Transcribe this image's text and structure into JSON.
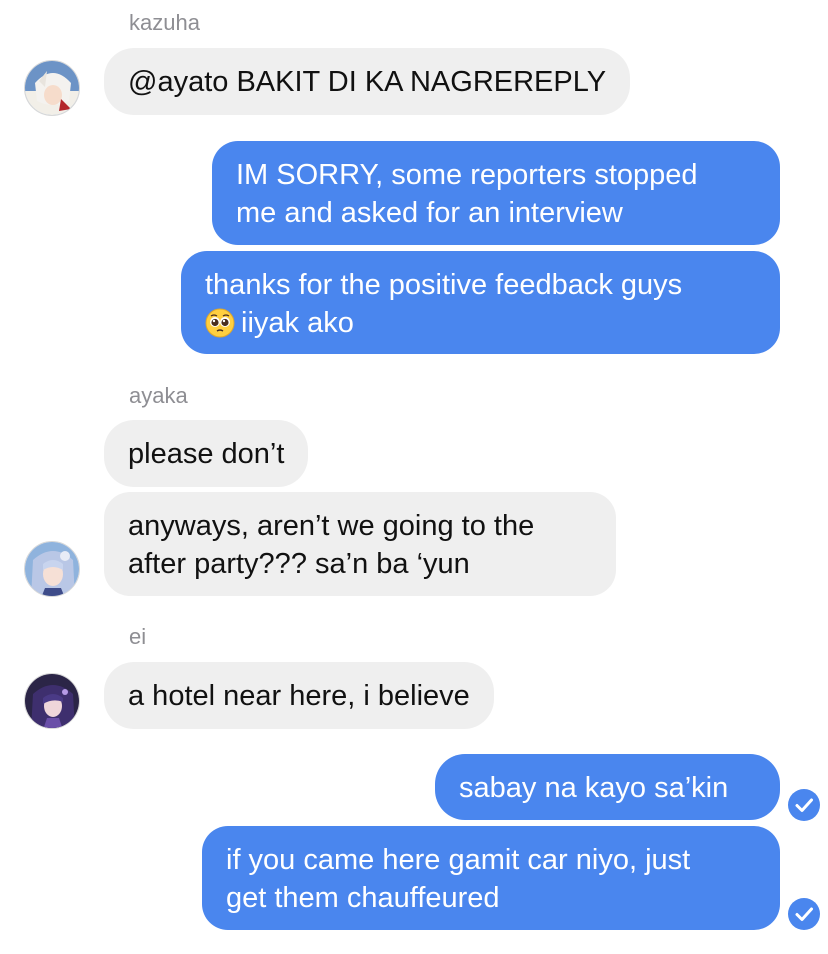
{
  "chat": {
    "groups": [
      {
        "sender": "kazuha",
        "avatar": "kazuha-avatar",
        "messages": [
          "@ayato BAKIT DI KA NAGREREPLY"
        ]
      },
      {
        "sender": "me",
        "messages": [
          {
            "lines": [
              "IM SORRY, some reporters stopped",
              "me and asked for an interview"
            ]
          },
          {
            "lines": [
              "thanks for the positive feedback guys",
              "iiyak ako"
            ],
            "emoji": "pleading-face-emoji"
          }
        ]
      },
      {
        "sender": "ayaka",
        "avatar": "ayaka-avatar",
        "messages": [
          "please don’t",
          {
            "lines": [
              "anyways, aren’t we going to the",
              "after party??? sa’n ba ‘yun"
            ]
          }
        ]
      },
      {
        "sender": "ei",
        "avatar": "ei-avatar",
        "messages": [
          "a hotel near here, i believe"
        ]
      },
      {
        "sender": "me",
        "messages": [
          {
            "text": "sabay na kayo sa’kin",
            "status": "read-check-icon"
          },
          {
            "lines": [
              "if you came here gamit car niyo, just",
              "get them chauffeured"
            ],
            "status": "read-check-icon"
          }
        ]
      }
    ]
  },
  "colors": {
    "outgoing_bubble": "#4a86ee",
    "incoming_bubble": "#efefef",
    "sender_name": "#8e8e93"
  }
}
